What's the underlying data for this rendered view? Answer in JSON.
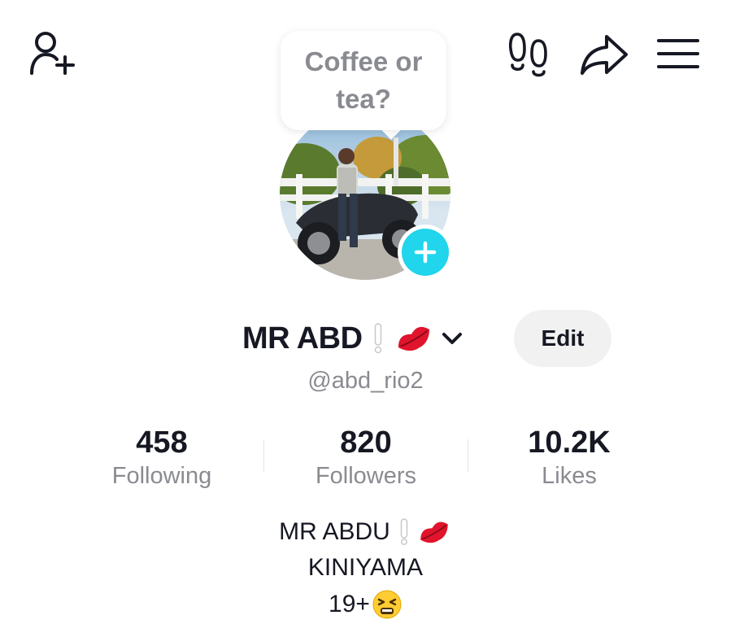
{
  "header": {
    "icons": {
      "add_friend": "add-user-icon",
      "profile_views": "footprints-icon",
      "share": "share-arrow-icon",
      "menu": "hamburger-menu-icon"
    }
  },
  "note": {
    "text": "Coffee or tea?"
  },
  "profile": {
    "display_name": "MR ABD",
    "name_emojis": [
      "white-exclamation-icon",
      "lips-icon"
    ],
    "username": "@abd_rio2",
    "edit_label": "Edit"
  },
  "stats": [
    {
      "value": "458",
      "label": "Following"
    },
    {
      "value": "820",
      "label": "Followers"
    },
    {
      "value": "10.2K",
      "label": "Likes"
    }
  ],
  "bio": {
    "line1": "MR ABDU",
    "line2": "KINIYAMA",
    "line3": "19+"
  },
  "colors": {
    "accent": "#20d5ec",
    "text_primary": "#161823",
    "text_secondary": "#8a8b91",
    "button_bg": "#f1f1f2",
    "lips": "#e0142c"
  }
}
